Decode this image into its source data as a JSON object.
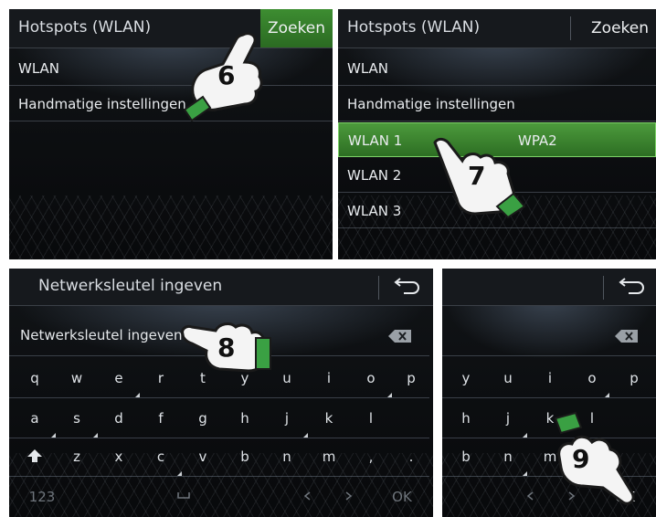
{
  "panel_top_left": {
    "title": "Hotspots (WLAN)",
    "search_label": "Zoeken",
    "items": [
      "WLAN",
      "Handmatige instellingen"
    ],
    "step": "6"
  },
  "panel_top_right": {
    "title": "Hotspots (WLAN)",
    "search_label": "Zoeken",
    "items": [
      "WLAN",
      "Handmatige instellingen"
    ],
    "networks": [
      {
        "name": "WLAN 1",
        "security": "WPA2"
      },
      {
        "name": "WLAN 2"
      },
      {
        "name": "WLAN 3"
      }
    ],
    "step": "7"
  },
  "panel_bottom_left": {
    "title": "Netwerksleutel ingeven",
    "input_placeholder": "Netwerksleutel ingeven",
    "row1": [
      "q",
      "w",
      "e",
      "r",
      "t",
      "y",
      "u",
      "i",
      "o",
      "p"
    ],
    "row2": [
      "a",
      "s",
      "d",
      "f",
      "g",
      "h",
      "j",
      "k",
      "l"
    ],
    "row3": [
      "z",
      "x",
      "c",
      "v",
      "b",
      "n",
      "m",
      ",",
      "."
    ],
    "mode_label": "123",
    "ok_label": "OK",
    "step": "8"
  },
  "panel_bottom_right": {
    "row1": [
      "y",
      "u",
      "i",
      "o",
      "p"
    ],
    "row2": [
      "h",
      "j",
      "k",
      "l"
    ],
    "row3": [
      "b",
      "n",
      "m"
    ],
    "ok_label": "OK",
    "step": "9"
  },
  "icons": [
    "back-icon",
    "backspace-icon",
    "shift-icon",
    "space-icon",
    "arrow-left-icon",
    "arrow-right-icon",
    "hand-pointer-icon"
  ],
  "colors": {
    "accent_green": "#3d8d31",
    "highlight_border": "#7ed36a",
    "background": "#0b0d10"
  }
}
